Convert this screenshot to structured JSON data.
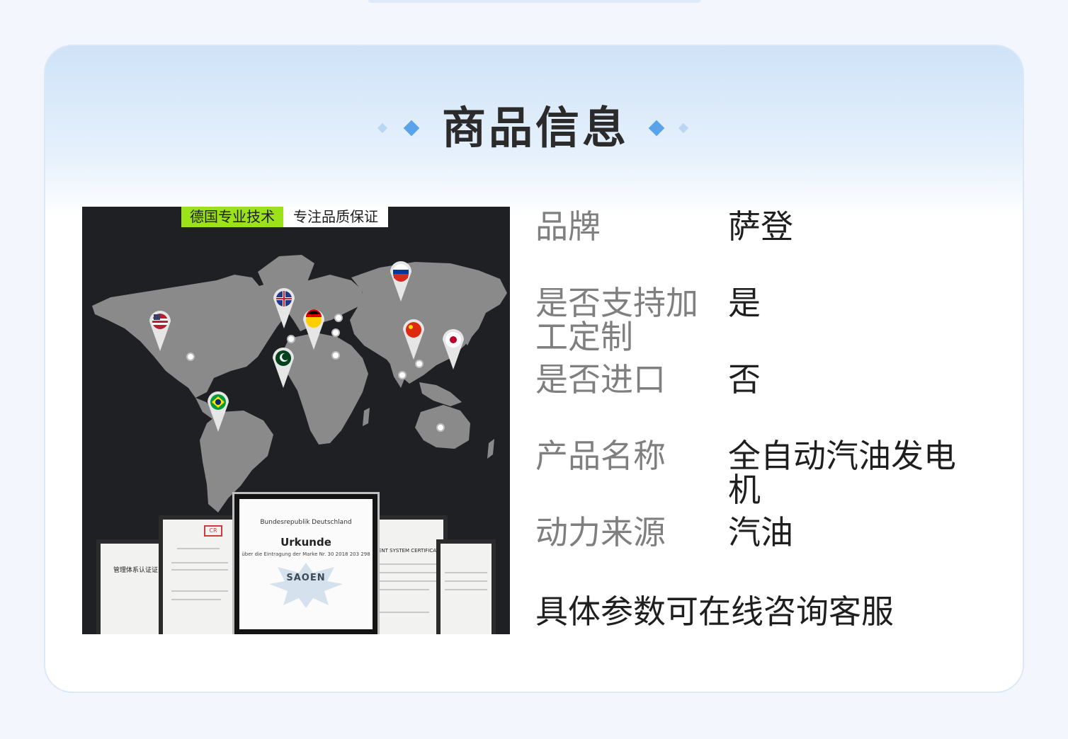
{
  "header": {
    "title": "商品信息"
  },
  "image": {
    "slogan_green": "德国专业技术",
    "slogan_white": "专注品质保证",
    "cert_left_title": "管理体系认证证",
    "cert_center_top": "Bundesrepublik Deutschland",
    "cert_center_title": "Urkunde",
    "cert_center_sub": "über die Eintragung der Marke Nr. 30 2018 203 298",
    "cert_center_brand": "SAOEN",
    "cert_right_title": "ENT SYSTEM CERTIFICATE",
    "pins": [
      {
        "name": "usa-flag-pin",
        "country": "USA"
      },
      {
        "name": "uk-flag-pin",
        "country": "UK"
      },
      {
        "name": "germany-flag-pin",
        "country": "Germany"
      },
      {
        "name": "russia-flag-pin",
        "country": "Russia"
      },
      {
        "name": "china-flag-pin",
        "country": "China"
      },
      {
        "name": "japan-flag-pin",
        "country": "Japan"
      },
      {
        "name": "pakistan-flag-pin",
        "country": "Pakistan"
      },
      {
        "name": "brazil-flag-pin",
        "country": "Brazil"
      }
    ]
  },
  "specs": [
    {
      "label": "品牌",
      "value": "萨登"
    },
    {
      "label": "是否支持加工定制",
      "value": "是"
    },
    {
      "label": "是否进口",
      "value": "否"
    },
    {
      "label": "产品名称",
      "value": "全自动汽油发电机"
    },
    {
      "label": "动力来源",
      "value": "汽油"
    }
  ],
  "note": "具体参数可在线咨询客服",
  "colors": {
    "accent": "#5aa3ea",
    "slogan_green": "#9be21b",
    "image_bg": "#1f2023",
    "map_land": "#8a8a8a"
  }
}
